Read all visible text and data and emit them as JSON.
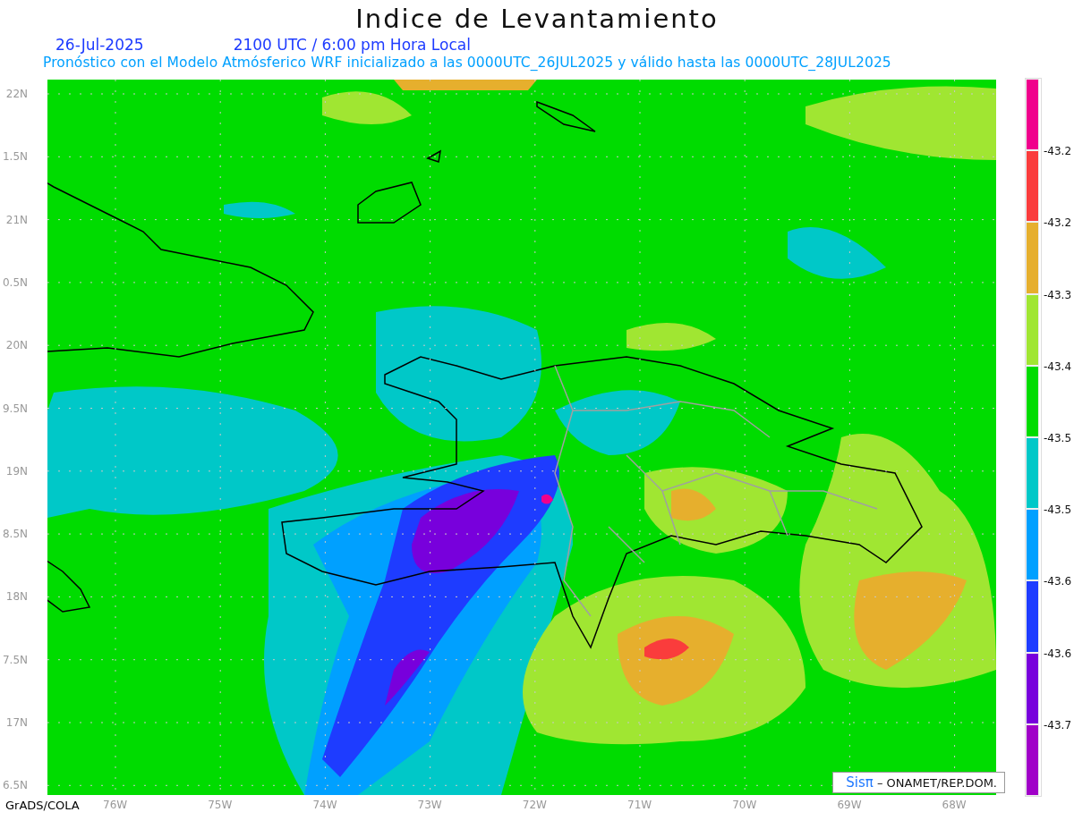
{
  "title": "Indice de Levantamiento",
  "date": "26-Jul-2025",
  "time": "2100 UTC / 6:00 pm Hora Local",
  "subtitle": "Pronóstico con el Modelo Atmósferico WRF inicializado a las 0000UTC_26JUL2025 y válido hasta las  0000UTC_28JUL2025",
  "y_axis": [
    "22N",
    "1.5N",
    "21N",
    "0.5N",
    "20N",
    "9.5N",
    "19N",
    "8.5N",
    "18N",
    "7.5N",
    "17N",
    "6.5N"
  ],
  "x_axis": [
    "76W",
    "75W",
    "74W",
    "73W",
    "72W",
    "71W",
    "70W",
    "69W",
    "68W"
  ],
  "legend": [
    {
      "color": "#f0008c",
      "label": "-43.2"
    },
    {
      "color": "#fa3c3c",
      "label": "-43.2"
    },
    {
      "color": "#e6af2d",
      "label": "-43.3"
    },
    {
      "color": "#a0e632",
      "label": "-43.4"
    },
    {
      "color": "#00dc00",
      "label": "-43.5"
    },
    {
      "color": "#00c8c8",
      "label": "-43.5"
    },
    {
      "color": "#00a0ff",
      "label": "-43.6"
    },
    {
      "color": "#1e3cff",
      "label": "-43.6"
    },
    {
      "color": "#7800dc",
      "label": "-43.7"
    },
    {
      "color": "#a000c8"
    }
  ],
  "credit": {
    "brand": "Sisπ",
    "text": "– ONAMET/REP.DOM."
  },
  "footer": "GrADS/COLA"
}
